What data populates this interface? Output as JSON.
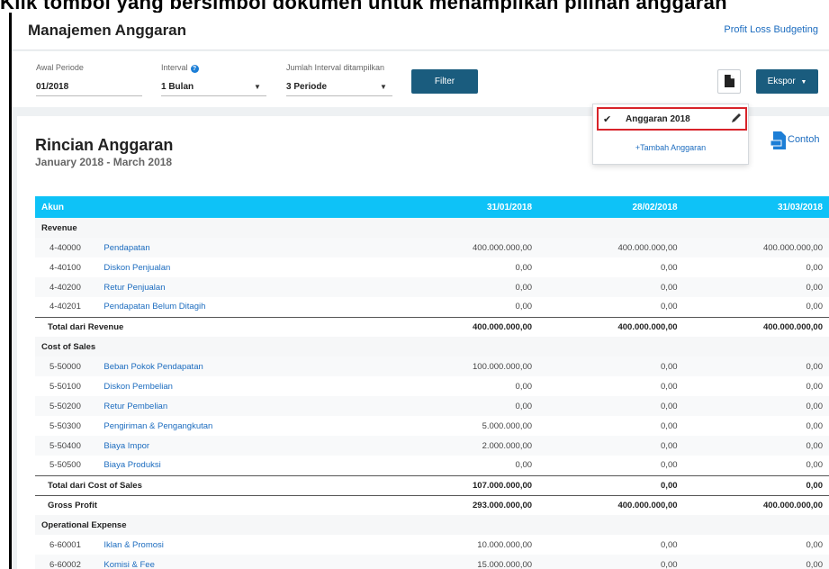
{
  "page": {
    "caption_strip": "Klik tombol yang bersimbol dokumen untuk menampilkan pilihan anggaran"
  },
  "header": {
    "title": "Manajemen Anggaran",
    "pl_link": "Profit Loss Budgeting"
  },
  "filters": {
    "awal_periode": {
      "label": "Awal Periode",
      "value": "01/2018"
    },
    "interval": {
      "label": "Interval",
      "value": "1 Bulan"
    },
    "jumlah": {
      "label": "Jumlah Interval ditampilkan",
      "value": "3 Periode"
    },
    "filter_button": "Filter",
    "ekspor_button": "Ekspor"
  },
  "dropdown": {
    "selected_label": "Anggaran 2018",
    "add_label": "+Tambah Anggaran"
  },
  "report": {
    "title": "Rincian Anggaran",
    "date_range": "January 2018 - March 2018",
    "contoh": "Contoh",
    "columns": [
      "Akun",
      "31/01/2018",
      "28/02/2018",
      "31/03/2018"
    ],
    "rows": [
      {
        "type": "section",
        "label": "Revenue"
      },
      {
        "type": "account",
        "code": "4-40000",
        "name": "Pendapatan",
        "values": [
          "400.000.000,00",
          "400.000.000,00",
          "400.000.000,00"
        ]
      },
      {
        "type": "account",
        "code": "4-40100",
        "name": "Diskon Penjualan",
        "values": [
          "0,00",
          "0,00",
          "0,00"
        ]
      },
      {
        "type": "account",
        "code": "4-40200",
        "name": "Retur Penjualan",
        "values": [
          "0,00",
          "0,00",
          "0,00"
        ]
      },
      {
        "type": "account",
        "code": "4-40201",
        "name": "Pendapatan Belum Ditagih",
        "values": [
          "0,00",
          "0,00",
          "0,00"
        ]
      },
      {
        "type": "total",
        "label": "Total dari Revenue",
        "values": [
          "400.000.000,00",
          "400.000.000,00",
          "400.000.000,00"
        ]
      },
      {
        "type": "section",
        "label": "Cost of Sales"
      },
      {
        "type": "account",
        "code": "5-50000",
        "name": "Beban Pokok Pendapatan",
        "values": [
          "100.000.000,00",
          "0,00",
          "0,00"
        ]
      },
      {
        "type": "account",
        "code": "5-50100",
        "name": "Diskon Pembelian",
        "values": [
          "0,00",
          "0,00",
          "0,00"
        ]
      },
      {
        "type": "account",
        "code": "5-50200",
        "name": "Retur Pembelian",
        "values": [
          "0,00",
          "0,00",
          "0,00"
        ]
      },
      {
        "type": "account",
        "code": "5-50300",
        "name": "Pengiriman & Pengangkutan",
        "values": [
          "5.000.000,00",
          "0,00",
          "0,00"
        ]
      },
      {
        "type": "account",
        "code": "5-50400",
        "name": "Biaya Impor",
        "values": [
          "2.000.000,00",
          "0,00",
          "0,00"
        ]
      },
      {
        "type": "account",
        "code": "5-50500",
        "name": "Biaya Produksi",
        "values": [
          "0,00",
          "0,00",
          "0,00"
        ]
      },
      {
        "type": "total",
        "label": "Total dari Cost of Sales",
        "values": [
          "107.000.000,00",
          "0,00",
          "0,00"
        ]
      },
      {
        "type": "total",
        "label": "Gross Profit",
        "values": [
          "293.000.000,00",
          "400.000.000,00",
          "400.000.000,00"
        ]
      },
      {
        "type": "section",
        "label": "Operational Expense"
      },
      {
        "type": "account",
        "code": "6-60001",
        "name": "Iklan & Promosi",
        "values": [
          "10.000.000,00",
          "0,00",
          "0,00"
        ]
      },
      {
        "type": "account",
        "code": "6-60002",
        "name": "Komisi & Fee",
        "values": [
          "15.000.000,00",
          "0,00",
          "0,00"
        ]
      }
    ]
  }
}
